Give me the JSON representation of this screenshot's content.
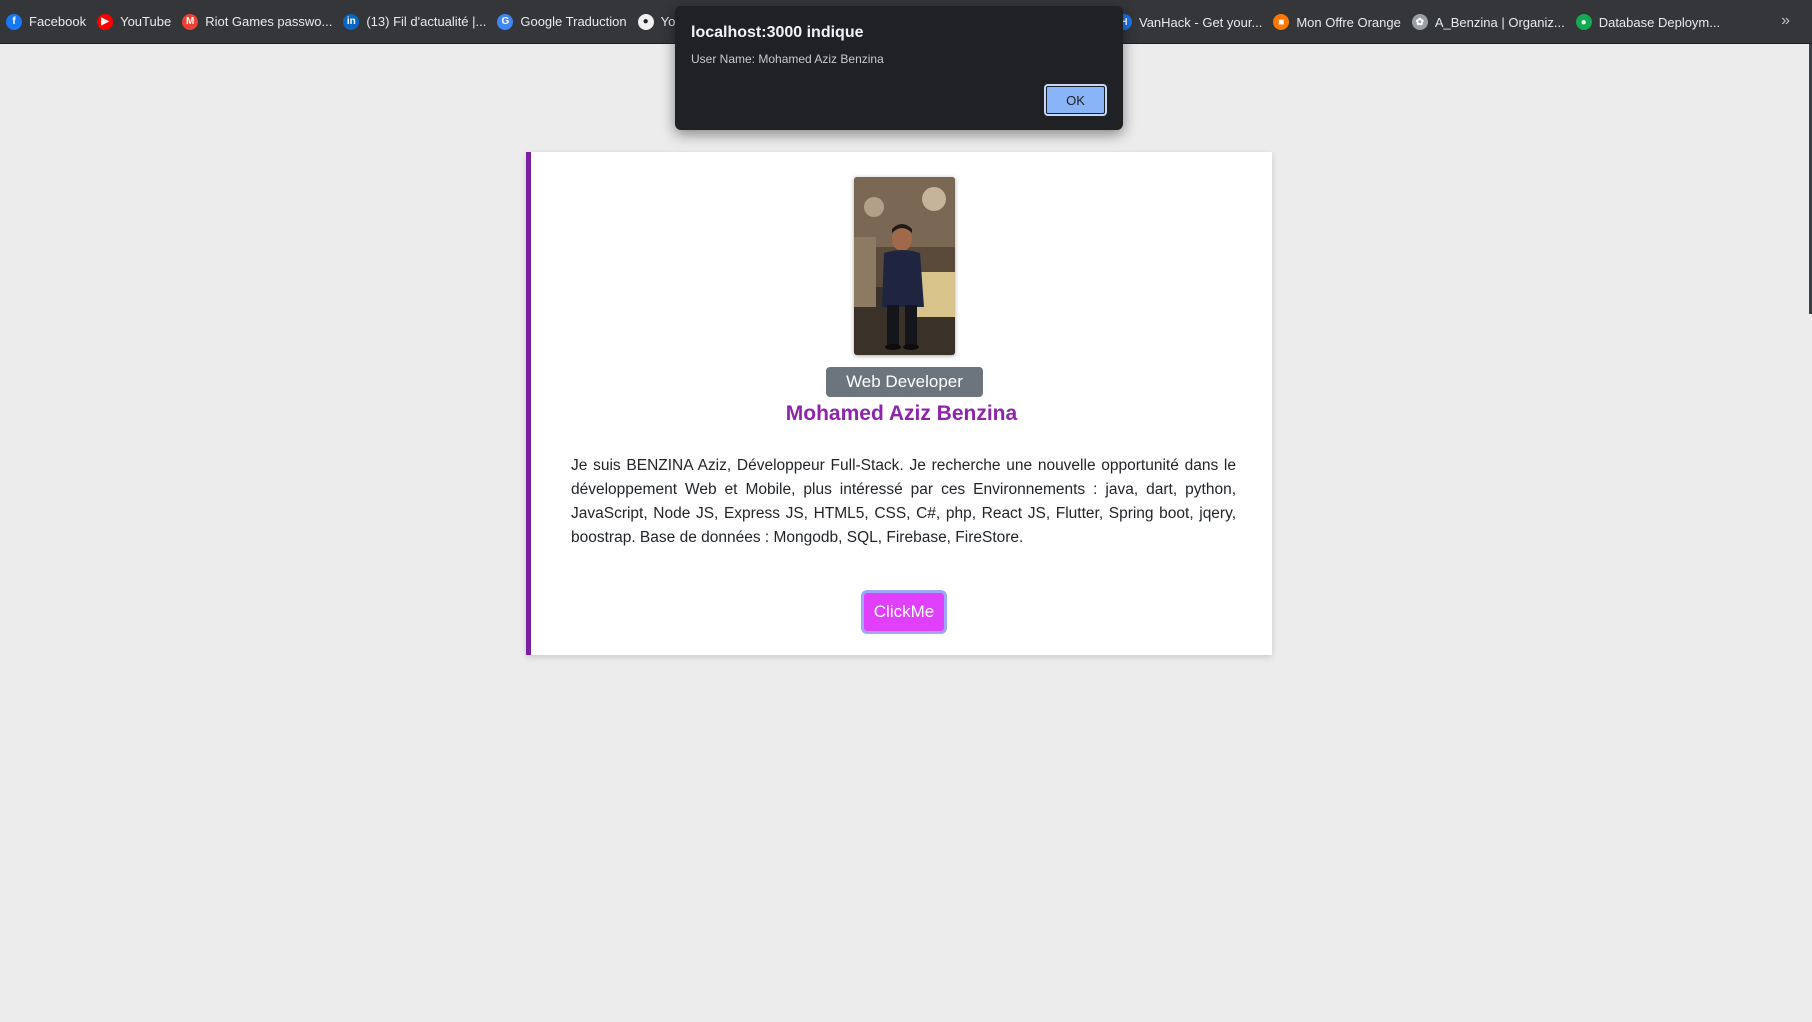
{
  "bookmarks": {
    "items": [
      {
        "label": "Facebook",
        "icon": "facebook-icon",
        "color": "#1877f2",
        "glyph": "f"
      },
      {
        "label": "YouTube",
        "icon": "youtube-icon",
        "color": "#ff0000",
        "glyph": "▶"
      },
      {
        "label": "Riot Games passwo...",
        "icon": "gmail-icon",
        "color": "#ea4335",
        "glyph": "M"
      },
      {
        "label": "(13) Fil d'actualité |...",
        "icon": "linkedin-icon",
        "color": "#0a66c2",
        "glyph": "in"
      },
      {
        "label": "Google Traduction",
        "icon": "google-translate-icon",
        "color": "#4285f4",
        "glyph": "G"
      },
      {
        "label": "Your Repo",
        "icon": "github-icon",
        "color": "#f0f0f0",
        "glyph": "●"
      }
    ],
    "right_items": [
      {
        "label": "VanHack - Get your...",
        "icon": "vanhack-icon",
        "color": "#1a73e8",
        "glyph": "H"
      },
      {
        "label": "Mon Offre Orange",
        "icon": "orange-icon",
        "color": "#ff7900",
        "glyph": "■"
      },
      {
        "label": "A_Benzina | Organiz...",
        "icon": "organization-icon",
        "color": "#9aa0a6",
        "glyph": "✿"
      },
      {
        "label": "Database Deploym...",
        "icon": "mongodb-icon",
        "color": "#13aa52",
        "glyph": "●"
      }
    ],
    "more_label": "»"
  },
  "alert": {
    "title": "localhost:3000 indique",
    "message": "User Name: Mohamed Aziz Benzina",
    "ok_label": "OK"
  },
  "profile": {
    "role": "Web Developer",
    "name": "Mohamed Aziz Benzina",
    "bio": "Je suis BENZINA Aziz, Développeur Full-Stack. Je recherche une nouvelle opportunité dans le développement Web et Mobile, plus intéressé par ces Environnements : java, dart, python, JavaScript, Node JS, Express JS, HTML5, CSS, C#, php, React JS, Flutter, Spring boot, jqery, boostrap. Base de données : Mongodb, SQL, Firebase, FireStore.",
    "button_label": "ClickMe"
  },
  "colors": {
    "accent_purple": "#8e24aa",
    "button_magenta": "#e040fb",
    "badge_gray": "#6c757d",
    "alert_ok_blue": "#8ab4f8"
  }
}
